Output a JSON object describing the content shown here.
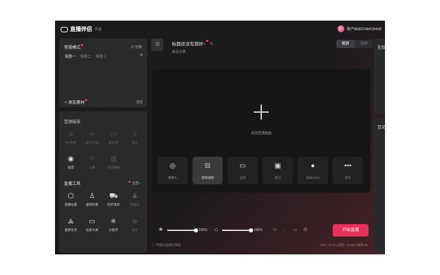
{
  "app": {
    "name": "直播伴侣",
    "subtitle": "抖音"
  },
  "user": {
    "label": "用户8682248418468"
  },
  "mode_panel": {
    "title": "常规模式",
    "switch_label": "⇄ 切换",
    "scenes": [
      "场景一",
      "场景二",
      "场景三"
    ],
    "add_material": "添加素材",
    "clear": "清空"
  },
  "interact_panel": {
    "title": "互动玩法",
    "items": [
      {
        "label": "PK连线",
        "icon": "pk-icon"
      },
      {
        "label": "观众连线",
        "icon": "link-icon"
      },
      {
        "label": "聊天室",
        "icon": "chat-icon"
      },
      {
        "label": "音乐",
        "icon": "music-icon"
      },
      {
        "label": "福袋",
        "icon": "luckybag-icon"
      },
      {
        "label": "心愿",
        "icon": "wish-icon"
      },
      {
        "label": "实时数据",
        "icon": "data-icon"
      }
    ]
  },
  "tools_panel": {
    "title": "直播工具",
    "all_label": "全部 ›",
    "items": [
      {
        "label": "直播设置",
        "icon": "settings-icon"
      },
      {
        "label": "虚拟形象",
        "icon": "avatar-icon"
      },
      {
        "label": "抖店电商",
        "icon": "cart-icon"
      },
      {
        "label": "管理员",
        "icon": "admin-icon"
      },
      {
        "label": "超燃任务",
        "icon": "task-icon"
      },
      {
        "label": "投屏大屏",
        "icon": "screen-icon"
      },
      {
        "label": "小程序",
        "icon": "miniapp-icon"
      },
      {
        "label": "更多",
        "icon": "more-icon"
      }
    ]
  },
  "header": {
    "title": "标题还没有想好~",
    "subtitle": "未设分类",
    "toggle": [
      "横屏",
      "竖屏"
    ]
  },
  "stage": {
    "add_label": "添加直播画面",
    "sources": [
      {
        "label": "摄像头",
        "icon": "camera-icon"
      },
      {
        "label": "游戏进程",
        "icon": "gamepad-icon"
      },
      {
        "label": "全屏",
        "icon": "monitor-icon"
      },
      {
        "label": "窗口",
        "icon": "window-icon"
      },
      {
        "label": "投屏(iOS)",
        "icon": "apple-icon"
      },
      {
        "label": "更多",
        "icon": "more-dots-icon"
      }
    ]
  },
  "controls": {
    "mic_volume": "100%",
    "speaker_volume": "100%",
    "mic_fraction": 1.0,
    "speaker_fraction": 1.0,
    "start_live": "开始直播"
  },
  "status": {
    "left": "不建议直播时游戏",
    "right": "CPU: 12.2%  内存: 73.46%  帧率:30"
  },
  "right_panels": {
    "top": "在线",
    "bottom": "互动"
  },
  "colors": {
    "accent": "#e8315a"
  }
}
